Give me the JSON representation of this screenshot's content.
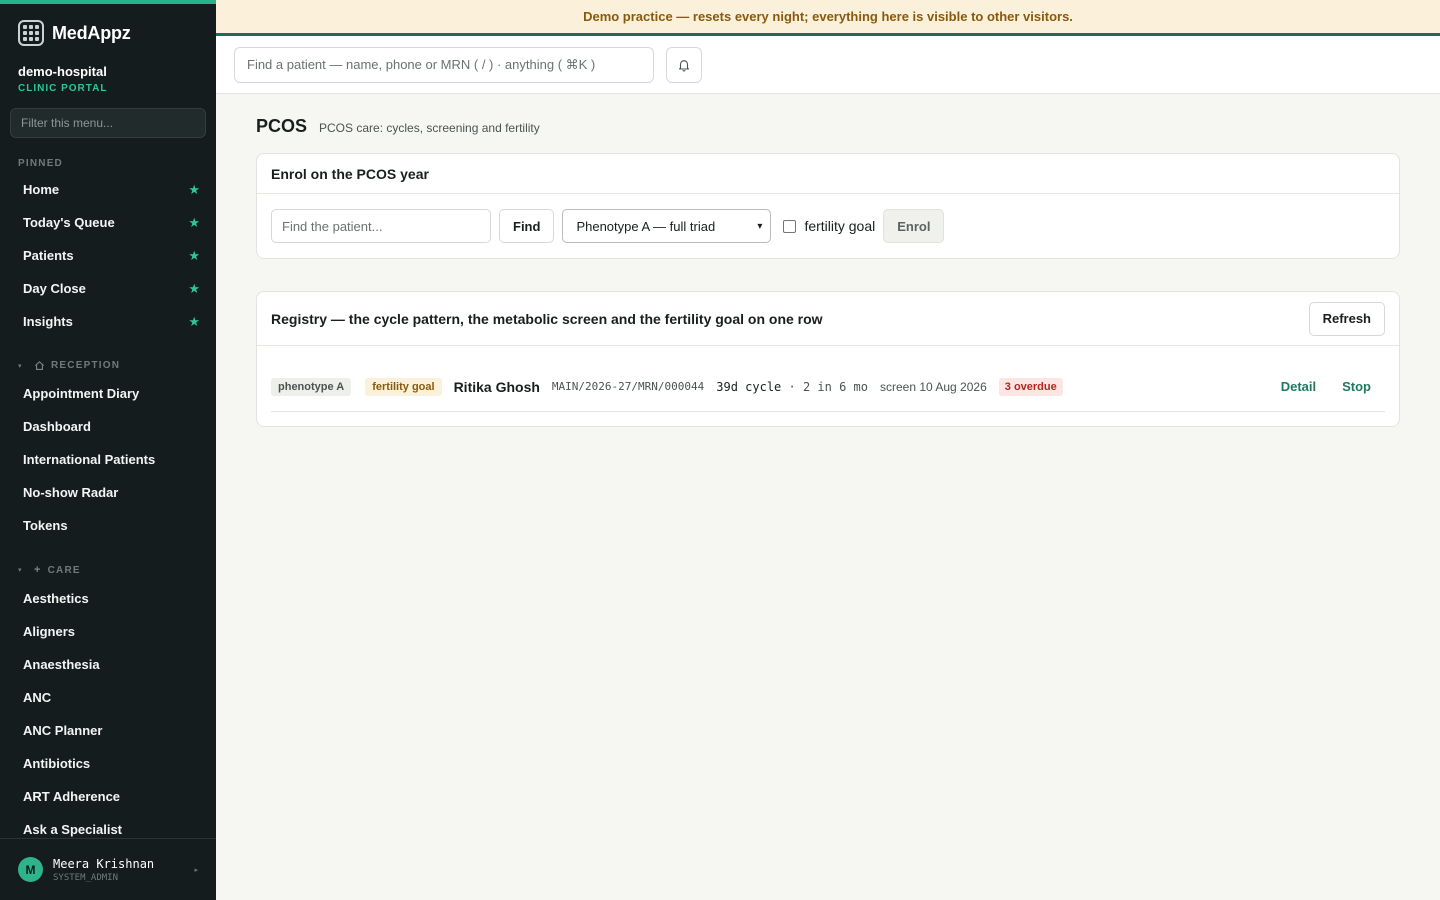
{
  "banner": "Demo practice — resets every night; everything here is visible to other visitors.",
  "brand": {
    "name": "MedAppz",
    "logo_icon": "app-grid-logo-icon"
  },
  "org": {
    "name": "demo-hospital",
    "portal": "CLINIC PORTAL"
  },
  "sidebar": {
    "filter_placeholder": "Filter this menu...",
    "pinned_label": "PINNED",
    "pinned": [
      {
        "label": "Home"
      },
      {
        "label": "Today's Queue"
      },
      {
        "label": "Patients"
      },
      {
        "label": "Day Close"
      },
      {
        "label": "Insights"
      }
    ],
    "groups": [
      {
        "label": "RECEPTION",
        "icon": "home-icon",
        "items": [
          {
            "label": "Appointment Diary"
          },
          {
            "label": "Dashboard"
          },
          {
            "label": "International Patients"
          },
          {
            "label": "No-show Radar"
          },
          {
            "label": "Tokens"
          }
        ]
      },
      {
        "label": "CARE",
        "icon": "plus-icon",
        "items": [
          {
            "label": "Aesthetics"
          },
          {
            "label": "Aligners"
          },
          {
            "label": "Anaesthesia"
          },
          {
            "label": "ANC"
          },
          {
            "label": "ANC Planner"
          },
          {
            "label": "Antibiotics"
          },
          {
            "label": "ART Adherence"
          },
          {
            "label": "Ask a Specialist"
          }
        ]
      }
    ]
  },
  "user": {
    "initial": "M",
    "name": "Meera Krishnan",
    "role": "SYSTEM_ADMIN"
  },
  "topbar": {
    "search_placeholder": "Find a patient — name, phone or MRN ( / ) · anything ( ⌘K )"
  },
  "page": {
    "title": "PCOS",
    "subtitle": "PCOS care: cycles, screening and fertility"
  },
  "enrol": {
    "heading": "Enrol on the PCOS year",
    "patient_placeholder": "Find the patient...",
    "find_label": "Find",
    "phenotype_selected": "Phenotype A — full triad",
    "fertility_label": "fertility goal",
    "enrol_label": "Enrol"
  },
  "registry": {
    "heading": "Registry — the cycle pattern, the metabolic screen and the fertility goal on one row",
    "refresh_label": "Refresh",
    "rows": [
      {
        "phenotype": "phenotype A",
        "fertility": "fertility goal",
        "name": "Ritika Ghosh",
        "mrn": "MAIN/2026-27/MRN/000044",
        "cycle": "39d cycle",
        "cycle_detail": "· 2 in 6 mo",
        "screen": "screen 10 Aug 2026",
        "overdue": "3 overdue",
        "detail_label": "Detail",
        "stop_label": "Stop"
      }
    ]
  },
  "colors": {
    "accent": "#26b38a",
    "sidebar_bg": "#141c1d",
    "banner_bg": "#fbf1da",
    "overdue": "#b3261e"
  }
}
